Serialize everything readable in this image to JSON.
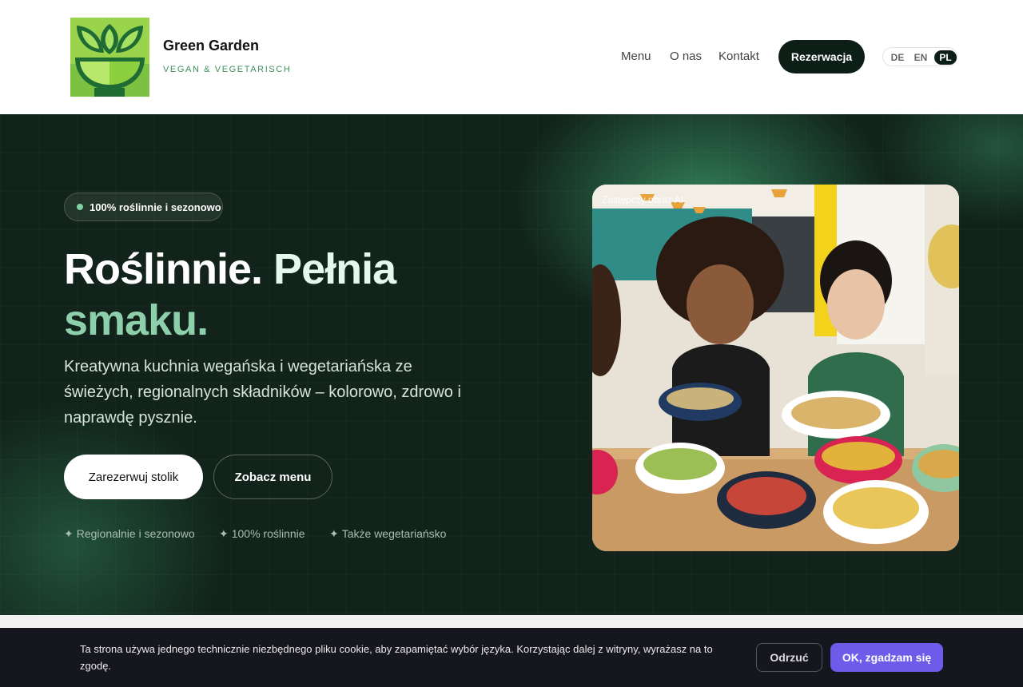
{
  "brand": {
    "name": "Green Garden",
    "tagline": "VEGAN & VEGETARISCH",
    "logo_icon": "leaf-bowl-icon"
  },
  "nav": {
    "links": [
      "Menu",
      "O nas",
      "Kontakt"
    ],
    "cta": "Rezerwacja",
    "languages": [
      "DE",
      "EN",
      "PL"
    ],
    "active_language": "PL"
  },
  "hero": {
    "badge": "100% roślinnie i sezonowo",
    "title_part1": "Roślinnie.",
    "title_part2": "Pełnia",
    "title_part3": "smaku.",
    "lead": "Kreatywna kuchnia wegańska i wegetariańska ze świeżych, regionalnych składników – kolorowo, zdrowo i naprawdę pysznie.",
    "primary_button": "Zarezerwuj stolik",
    "secondary_button": "Zobacz menu",
    "features": [
      "Regionalnie i sezonowo",
      "100% roślinnie",
      "Także wegetariańsko"
    ],
    "feature_icon": "sparkle-icon",
    "image_label": "Zastępczy obraz AI"
  },
  "cookie": {
    "text": "Ta strona używa jednego technicznie niezbędnego pliku cookie, aby zapamiętać wybór języka. Korzystając dalej z witryny, wyrażasz na to zgodę.",
    "refuse": "Odrzuć",
    "accept": "OK, zgadzam się"
  },
  "colors": {
    "hero_bg": "#11231a",
    "accent_green": "#8ccfaa",
    "cta_dark": "#0d1e16",
    "accept_purple": "#6f5bea"
  }
}
